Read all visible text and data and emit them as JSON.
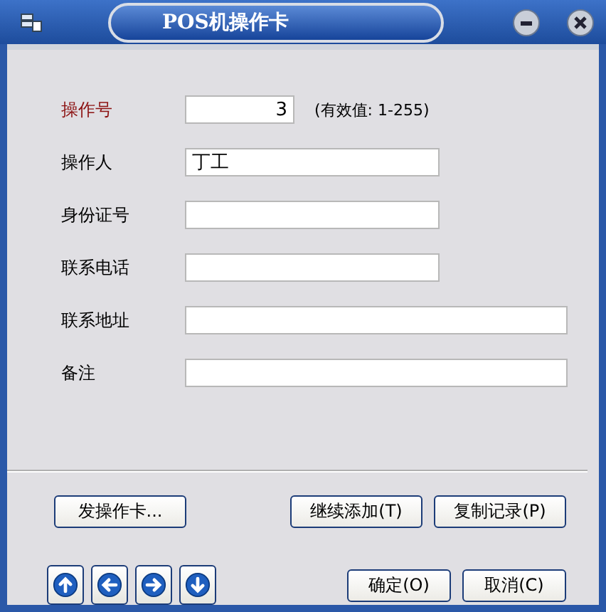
{
  "window": {
    "title": "POS机操作卡"
  },
  "fields": [
    {
      "label": "操作号",
      "value": "3",
      "required": true,
      "kind": "short",
      "hint": "(有效值: 1-255)"
    },
    {
      "label": "操作人",
      "value": "丁工",
      "required": false,
      "kind": "medium"
    },
    {
      "label": "身份证号",
      "required": false,
      "kind": "medium"
    },
    {
      "label": "联系电话",
      "required": false,
      "kind": "medium"
    },
    {
      "label": "联系地址",
      "required": false,
      "kind": "long"
    },
    {
      "label": "备注",
      "required": false,
      "kind": "long"
    }
  ],
  "action_buttons": [
    "发操作卡..."
  ],
  "record_buttons": [
    "继续添加(T)",
    "复制记录(P)"
  ],
  "dialog_buttons": [
    "确定(O)",
    "取消(C)"
  ]
}
